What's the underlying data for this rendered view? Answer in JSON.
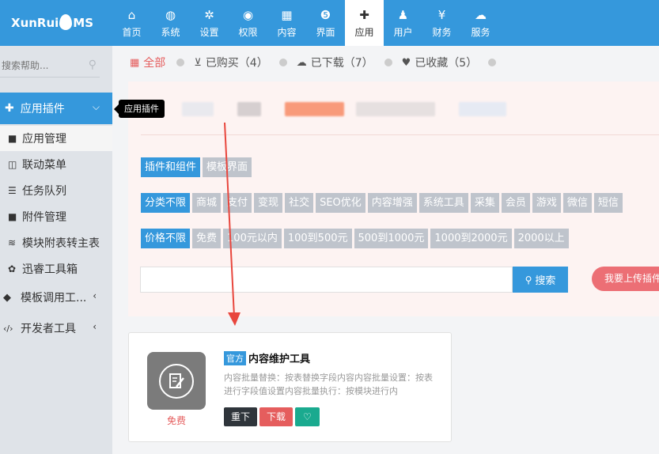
{
  "logo": {
    "text_a": "XunRui",
    "text_b": "MS"
  },
  "nav": [
    {
      "label": "首页",
      "icon": "home-icon",
      "glyph": "⌂"
    },
    {
      "label": "系统",
      "icon": "globe-icon",
      "glyph": "◍"
    },
    {
      "label": "设置",
      "icon": "gears-icon",
      "glyph": "✲"
    },
    {
      "label": "权限",
      "icon": "user-circle-icon",
      "glyph": "◉"
    },
    {
      "label": "内容",
      "icon": "grid-icon",
      "glyph": "▦"
    },
    {
      "label": "界面",
      "icon": "html5-icon",
      "glyph": "❺"
    },
    {
      "label": "应用",
      "icon": "puzzle-icon",
      "glyph": "✚"
    },
    {
      "label": "用户",
      "icon": "user-icon",
      "glyph": "♟"
    },
    {
      "label": "财务",
      "icon": "yen-icon",
      "glyph": "¥"
    },
    {
      "label": "服务",
      "icon": "cloud-icon",
      "glyph": "☁"
    }
  ],
  "sidebar": {
    "search_placeholder": "搜索帮助...",
    "header": {
      "label": "应用插件"
    },
    "items": [
      {
        "label": "应用管理",
        "glyph": "■"
      },
      {
        "label": "联动菜单",
        "glyph": "◫"
      },
      {
        "label": "任务队列",
        "glyph": "☰"
      },
      {
        "label": "附件管理",
        "glyph": "■"
      },
      {
        "label": "模块附表转主表",
        "glyph": "≋"
      },
      {
        "label": "迅睿工具箱",
        "glyph": "✿"
      }
    ],
    "groups": [
      {
        "label": "模板调用工...",
        "glyph": "◆"
      },
      {
        "label": "开发者工具",
        "glyph": "‹/›"
      }
    ]
  },
  "tooltip": "应用插件",
  "tabs": [
    {
      "label": "全部"
    },
    {
      "label": "已购买（4）"
    },
    {
      "label": "已下载（7）"
    },
    {
      "label": "已收藏（5）"
    }
  ],
  "filters": {
    "type": [
      "插件和组件",
      "模板界面"
    ],
    "category": [
      "分类不限",
      "商城",
      "支付",
      "变现",
      "社交",
      "SEO优化",
      "内容增强",
      "系统工具",
      "采集",
      "会员",
      "游戏",
      "微信",
      "短信"
    ],
    "price": [
      "价格不限",
      "免费",
      "100元以内",
      "100到500元",
      "500到1000元",
      "1000到2000元",
      "2000以上"
    ]
  },
  "search": {
    "button": "搜索",
    "upload": "我要上传插件"
  },
  "card": {
    "badge": "官方",
    "title": "内容维护工具",
    "desc": "内容批量替换：按表替换字段内容内容批量设置：按表进行字段值设置内容批量执行：按模块进行内",
    "price": "免费",
    "btn_reinstall": "重下",
    "btn_download": "下载"
  },
  "colors": {
    "primary": "#3598dc",
    "danger": "#e55d5d",
    "teal": "#1aaa8f",
    "dark": "#2f353b"
  }
}
